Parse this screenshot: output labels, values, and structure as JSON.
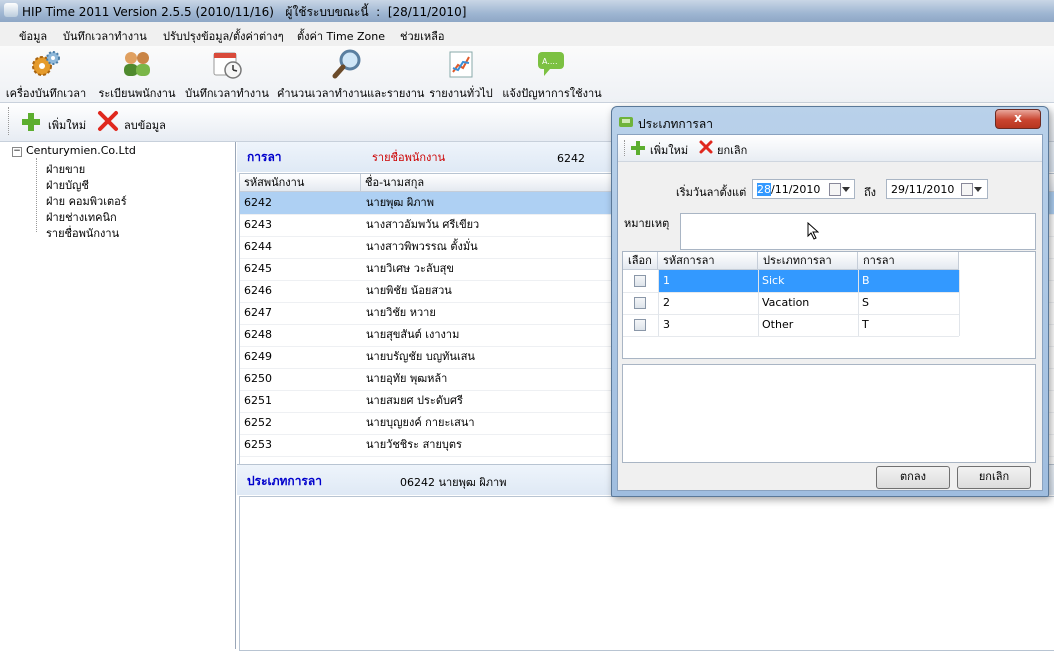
{
  "window": {
    "title": "HIP Time 2011 Version 2.5.5 (2010/11/16)   ผู้ใช้ระบบขณะนี้  :  [28/11/2010]"
  },
  "menu": [
    "ข้อมูล",
    "บันทึกเวลาทำงาน",
    "ปรับปรุงข้อมูล/ตั้งค่าต่างๆ",
    "ตั้งค่า Time Zone",
    "ช่วยเหลือ"
  ],
  "toolbar": {
    "items": [
      {
        "label": "เครื่องบันทึกเวลา",
        "icon": "gears-icon"
      },
      {
        "label": "ระเบียนพนักงาน",
        "icon": "people-icon"
      },
      {
        "label": "บันทึกเวลาทำงาน",
        "icon": "calendar-clock-icon"
      },
      {
        "label": "คำนวนเวลาทำงานและรายงาน",
        "icon": "magnifier-icon"
      },
      {
        "label": "รายงานทั่วไป",
        "icon": "report-chart-icon"
      },
      {
        "label": "แจ้งปัญหาการใช้งาน",
        "icon": "speech-bubble-icon"
      }
    ],
    "bubble_text": "A...."
  },
  "subtoolbar": {
    "add_label": "เพิ่มใหม่",
    "delete_label": "ลบข้อมูล"
  },
  "tree": {
    "root": "Centurymien.Co.Ltd",
    "children": [
      "ฝ่ายขาย",
      "ฝ่ายบัญชี",
      "ฝ่าย คอมพิวเตอร์",
      "ฝ่ายช่างเทคนิก",
      "รายชื่อพนักงาน"
    ]
  },
  "leave_panel": {
    "title": "การลา",
    "list_title": "รายชื่อพนักงาน",
    "selected_id": "6242"
  },
  "employee_grid": {
    "columns": [
      "รหัสพนักงาน",
      "ชื่อ-นามสกุล"
    ],
    "rows": [
      {
        "id": "6242",
        "name": "นายพุฒ  ผิภาพ",
        "selected": true
      },
      {
        "id": "6243",
        "name": "นางสาวอัมพวัน  ศรีเขียว"
      },
      {
        "id": "6244",
        "name": "นางสาวพิพวรรณ  ตั้งมั่น"
      },
      {
        "id": "6245",
        "name": "นายวิเศษ  วะลับสุข"
      },
      {
        "id": "6246",
        "name": "นายพิชัย  น้อยสวน"
      },
      {
        "id": "6247",
        "name": "นายวิชัย  หวาย"
      },
      {
        "id": "6248",
        "name": "นายสุขสันต์  เงางาม"
      },
      {
        "id": "6249",
        "name": "นายบรัญชัย  บญทันเสน"
      },
      {
        "id": "6250",
        "name": "นายอุทัย  พุฒหล้า"
      },
      {
        "id": "6251",
        "name": "นายสมยศ  ประดับศรี"
      },
      {
        "id": "6252",
        "name": "นายบุญยงค์  กายะเสนา"
      },
      {
        "id": "6253",
        "name": "นายวัชชิระ  สายบุตร"
      }
    ]
  },
  "leave_type_panel": {
    "title": "ประเภทการลา",
    "employee": "06242  นายพุฒ  ผิภาพ"
  },
  "dialog": {
    "title": "ประเภทการลา",
    "close": "x",
    "add_label": "เพิ่มใหม่",
    "cancel_label": "ยกเลิก",
    "from_label": "เริ่มวันลาตั้งแต่",
    "from_day": "28",
    "from_rest": "/11/2010",
    "to_label": "ถึง",
    "to_date": "29/11/2010",
    "note_label": "หมายเหตุ",
    "columns": [
      "เลือก",
      "รหัสการลา",
      "ประเภทการลา",
      "การลา"
    ],
    "rows": [
      {
        "code": "1",
        "type": "Sick",
        "abbr": "B",
        "selected": true
      },
      {
        "code": "2",
        "type": "Vacation",
        "abbr": "S"
      },
      {
        "code": "3",
        "type": "Other",
        "abbr": "T"
      }
    ],
    "ok_button": "ตกลง",
    "cancel_button": "ยกเลิก"
  },
  "colors": {
    "accent": "#3399ff",
    "selection": "#aed0f3",
    "title_blue": "#0000cc",
    "list_red": "#cc0000"
  }
}
